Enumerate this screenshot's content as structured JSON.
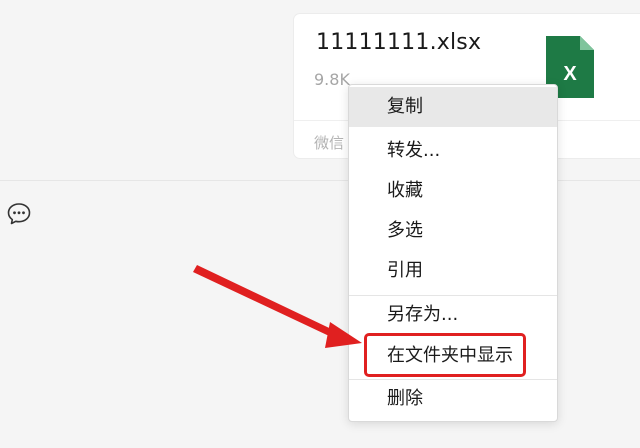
{
  "message": {
    "file_name": "11111111.xlsx",
    "file_size": "9.8K",
    "source": "微信",
    "file_icon_label": "X",
    "file_icon_name": "excel-file-icon"
  },
  "more_icon": "chat-more-icon",
  "context_menu": {
    "items": [
      {
        "label": "复制"
      },
      {
        "label": "转发..."
      },
      {
        "label": "收藏"
      },
      {
        "label": "多选"
      },
      {
        "label": "引用"
      },
      {
        "label": "另存为..."
      },
      {
        "label": "在文件夹中显示"
      },
      {
        "label": "删除"
      }
    ],
    "hovered_item": "复制",
    "highlighted_item": "在文件夹中显示"
  },
  "colors": {
    "excel_green": "#1e7a45",
    "annotation_red": "#e02020",
    "menu_hover": "#e8e8e8"
  }
}
